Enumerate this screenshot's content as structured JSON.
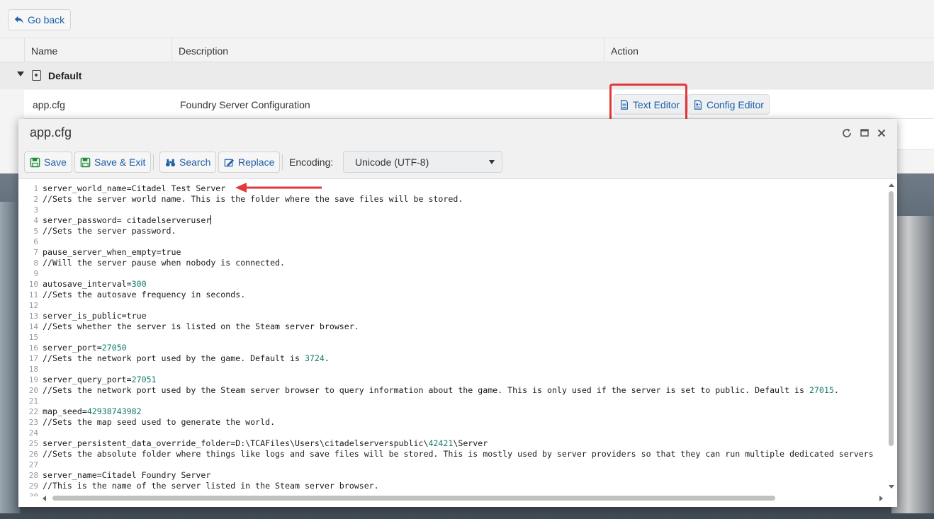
{
  "topbar": {
    "back_label": "Go back"
  },
  "table": {
    "headers": {
      "name": "Name",
      "description": "Description",
      "action": "Action"
    },
    "group": "Default",
    "row": {
      "name": "app.cfg",
      "description": "Foundry Server Configuration",
      "text_editor_label": "Text Editor",
      "config_editor_label": "Config Editor"
    }
  },
  "dialog": {
    "title": "app.cfg",
    "toolbar": {
      "save": "Save",
      "save_exit": "Save & Exit",
      "search": "Search",
      "replace": "Replace",
      "encoding_label": "Encoding:",
      "encoding_value": "Unicode (UTF-8)"
    },
    "lines": [
      "server_world_name=Citadel Test Server",
      "//Sets the server world name. This is the folder where the save files will be stored.",
      "",
      "server_password= citadelserveruser",
      "//Sets the server password.",
      "",
      "pause_server_when_empty=true",
      "//Will the server pause when nobody is connected.",
      "",
      "autosave_interval=300",
      "//Sets the autosave frequency in seconds.",
      "",
      "server_is_public=true",
      "//Sets whether the server is listed on the Steam server browser.",
      "",
      "server_port=27050",
      "//Sets the network port used by the game. Default is 3724.",
      "",
      "server_query_port=27051",
      "//Sets the network port used by the Steam server browser to query information about the game. This is only used if the server is set to public. Default is 27015.",
      "",
      "map_seed=42938743982",
      "//Sets the map seed used to generate the world.",
      "",
      "server_persistent_data_override_folder=D:\\TCAFiles\\Users\\citadelserverspublic\\42421\\Server",
      "//Sets the absolute folder where things like logs and save files will be stored. This is mostly used by server providers so that they can run multiple dedicated servers",
      "",
      "server_name=Citadel Foundry Server",
      "//This is the name of the server listed in the Steam server browser.",
      ""
    ]
  },
  "colors": {
    "accent": "#1f5fa8",
    "highlight": "#e13a3a",
    "number": "#117a6b"
  },
  "icons": [
    "back-arrow-icon",
    "document-icon",
    "config-document-icon",
    "save-icon",
    "save-exit-icon",
    "binoculars-icon",
    "replace-icon",
    "refresh-icon",
    "maximize-icon",
    "close-icon"
  ]
}
